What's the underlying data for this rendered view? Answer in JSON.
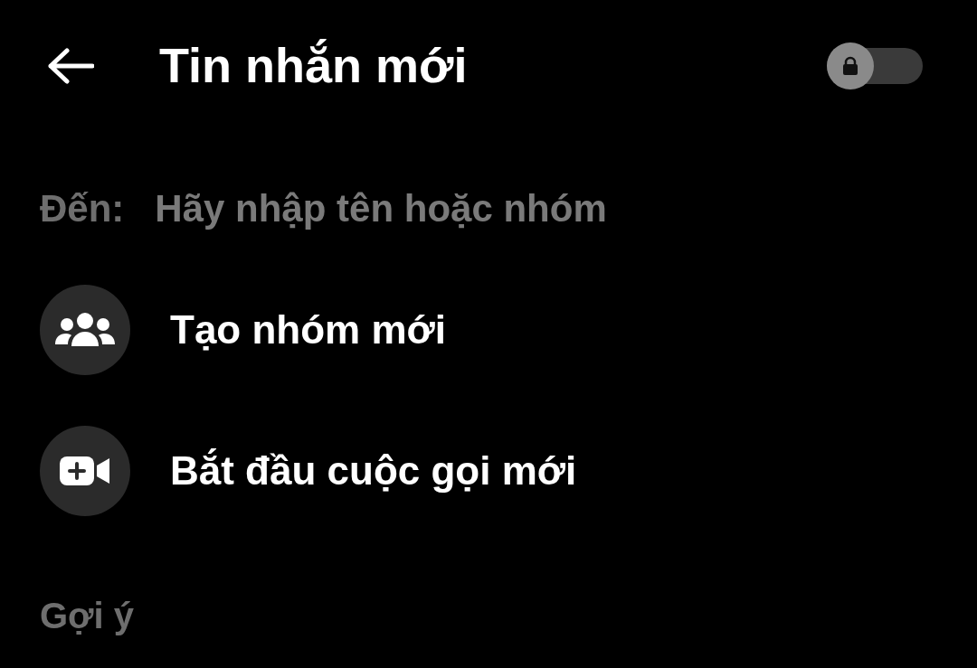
{
  "header": {
    "title": "Tin nhắn mới",
    "toggle": {
      "on": false
    }
  },
  "recipient": {
    "label": "Đến:",
    "placeholder": "Hãy nhập tên hoặc nhóm"
  },
  "actions": [
    {
      "kind": "group",
      "label": "Tạo nhóm mới"
    },
    {
      "kind": "call",
      "label": "Bắt đầu cuộc gọi mới"
    }
  ],
  "section": "Gợi ý"
}
